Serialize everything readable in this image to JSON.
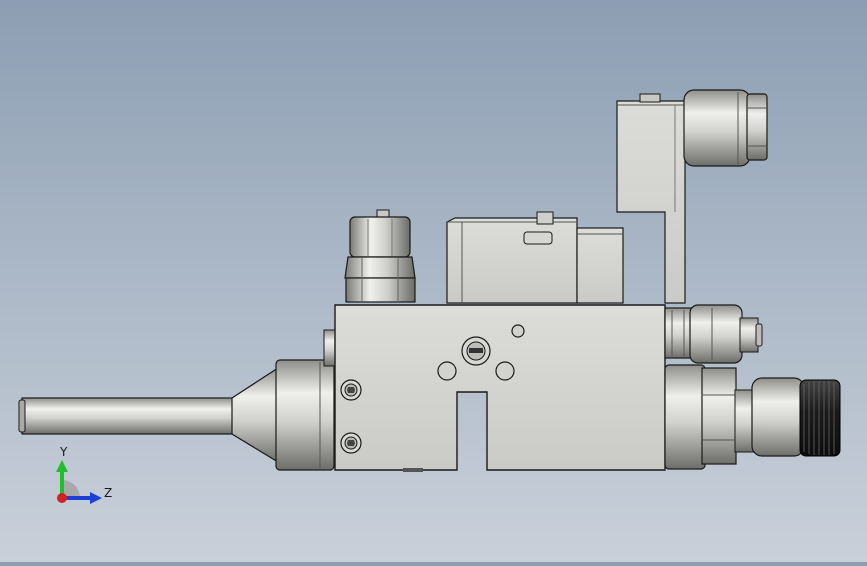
{
  "viewport": {
    "background_top": "#8c9eb3",
    "background_bottom": "#c9d0da",
    "model_color": "#d6d6d2",
    "edge_color": "#1a1a1a"
  },
  "triad": {
    "y_label": "Y",
    "z_label": "Z",
    "y_color": "#1fbf2a",
    "z_color": "#1c3fd6",
    "x_color": "#d42020"
  }
}
